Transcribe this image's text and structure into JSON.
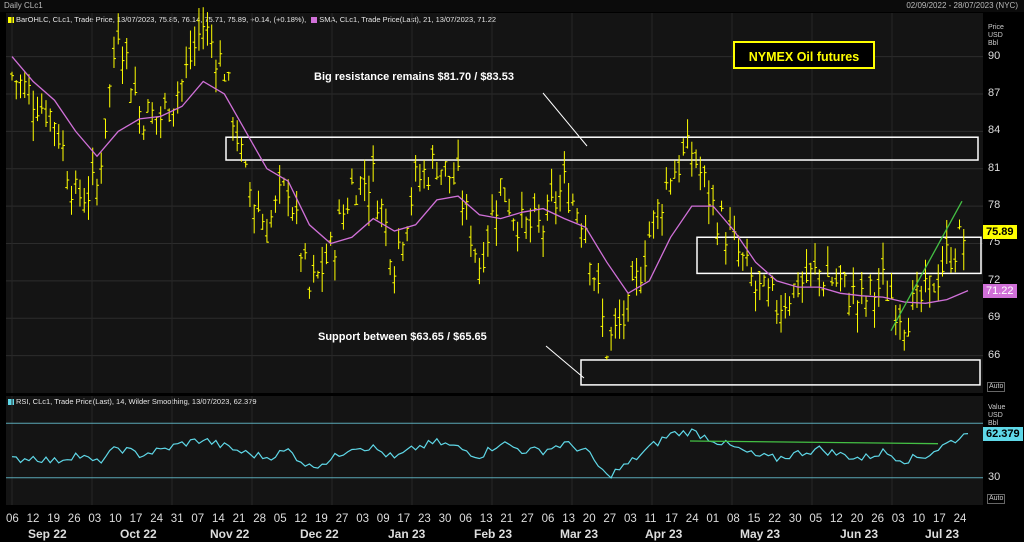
{
  "window": {
    "title": "Daily CLc1",
    "date_range": "02/09/2022 - 28/07/2023 (NYC)"
  },
  "legend": {
    "price_series": "BarOHLC, CLc1, Trade Price, 13/07/2023, 75.85, 76.14, 75.71, 75.89, +0.14, (+0.18%),",
    "sma_series": "SMA, CLc1, Trade Price(Last),  21, 13/07/2023, 71.22",
    "rsi_series": "RSI, CLc1, Trade Price(Last),  14, Wilder Smoothing, 13/07/2023, 62.379"
  },
  "price_axis": {
    "unit_lines": [
      "Price",
      "USD",
      "Bbl"
    ],
    "auto": "Auto"
  },
  "rsi_axis": {
    "unit_lines": [
      "Value",
      "USD",
      "Bbl"
    ],
    "auto": "Auto"
  },
  "annotations": {
    "badge": "NYMEX Oil futures",
    "resistance": "Big resistance remains $81.70 / $83.53",
    "support": "Support between $63.65 / $65.65"
  },
  "colors": {
    "price_bars": "#ffff00",
    "sma": "#d070d8",
    "rsi": "#5fd8e8",
    "trendline": "#44c044",
    "zone_box": "#ffffff",
    "last_price_tag": "#ffff00",
    "sma_tag": "#d070d8",
    "rsi_tag": "#5fd8e8"
  },
  "chart_data": [
    {
      "type": "ohlc",
      "title": "Daily CLc1",
      "ylabel": "Price USD Bbl",
      "ylim": [
        63,
        93.5
      ],
      "yticks": [
        66,
        69,
        72,
        75,
        78,
        81,
        84,
        87,
        90
      ],
      "grid": true,
      "last_price": 75.89,
      "last_sma": 71.22,
      "x": [
        "2022-09-02",
        "2022-09-09",
        "2022-09-16",
        "2022-09-23",
        "2022-09-30",
        "2022-10-07",
        "2022-10-14",
        "2022-10-21",
        "2022-10-28",
        "2022-11-04",
        "2022-11-11",
        "2022-11-18",
        "2022-11-25",
        "2022-12-02",
        "2022-12-09",
        "2022-12-16",
        "2022-12-23",
        "2022-12-30",
        "2023-01-06",
        "2023-01-13",
        "2023-01-20",
        "2023-01-27",
        "2023-02-03",
        "2023-02-10",
        "2023-02-17",
        "2023-02-24",
        "2023-03-03",
        "2023-03-10",
        "2023-03-17",
        "2023-03-24",
        "2023-03-31",
        "2023-04-06",
        "2023-04-14",
        "2023-04-21",
        "2023-04-28",
        "2023-05-05",
        "2023-05-12",
        "2023-05-19",
        "2023-05-26",
        "2023-06-02",
        "2023-06-09",
        "2023-06-16",
        "2023-06-23",
        "2023-06-30",
        "2023-07-07",
        "2023-07-13"
      ],
      "close": [
        88.5,
        86.8,
        85.1,
        78.7,
        79.5,
        92.6,
        85.6,
        85.1,
        87.9,
        92.6,
        89.0,
        80.1,
        76.3,
        79.9,
        71.0,
        74.3,
        79.6,
        80.3,
        73.8,
        79.9,
        81.6,
        79.7,
        73.4,
        79.7,
        76.3,
        76.3,
        79.7,
        76.7,
        66.7,
        69.3,
        75.7,
        80.7,
        82.5,
        77.9,
        74.8,
        71.3,
        70.0,
        71.7,
        72.7,
        71.7,
        70.2,
        71.8,
        69.2,
        70.6,
        73.9,
        75.89
      ],
      "sma": [
        90.0,
        88.0,
        86.5,
        84.0,
        82.0,
        84.0,
        85.0,
        85.2,
        86.0,
        88.0,
        87.0,
        84.0,
        81.0,
        80.0,
        76.5,
        75.0,
        75.5,
        77.0,
        76.0,
        76.5,
        78.5,
        78.8,
        77.3,
        77.0,
        77.5,
        77.8,
        77.0,
        76.3,
        73.5,
        71.0,
        72.0,
        75.5,
        78.0,
        78.0,
        76.0,
        73.5,
        72.0,
        71.5,
        71.5,
        71.0,
        70.8,
        70.7,
        70.3,
        70.2,
        70.5,
        71.22
      ],
      "zones": [
        {
          "name": "Big resistance",
          "low": 81.7,
          "high": 83.53
        },
        {
          "name": "Support",
          "low": 63.65,
          "high": 65.65
        }
      ]
    },
    {
      "type": "line",
      "title": "RSI",
      "series_name": "RSI 14, Wilder Smoothing",
      "yticks": [
        30
      ],
      "last_value": 62.379,
      "values": [
        43,
        45,
        42,
        47,
        41,
        52,
        47,
        50,
        55,
        58,
        53,
        48,
        45,
        50,
        38,
        43,
        53,
        52,
        44,
        52,
        56,
        52,
        46,
        56,
        50,
        50,
        55,
        50,
        31,
        40,
        52,
        62,
        64,
        58,
        52,
        46,
        44,
        48,
        51,
        47,
        44,
        49,
        43,
        46,
        55,
        62.379
      ]
    }
  ],
  "x_axis": {
    "days": [
      "06",
      "12",
      "19",
      "26",
      "03",
      "10",
      "17",
      "24",
      "31",
      "07",
      "14",
      "21",
      "28",
      "05",
      "12",
      "19",
      "27",
      "03",
      "09",
      "17",
      "23",
      "30",
      "06",
      "13",
      "21",
      "27",
      "06",
      "13",
      "20",
      "27",
      "03",
      "11",
      "17",
      "24",
      "01",
      "08",
      "15",
      "22",
      "30",
      "05",
      "12",
      "20",
      "26",
      "03",
      "10",
      "17",
      "24"
    ],
    "months": [
      "Sep 22",
      "Oct 22",
      "Nov 22",
      "Dec 22",
      "Jan 23",
      "Feb 23",
      "Mar 23",
      "Apr 23",
      "May 23",
      "Jun 23",
      "Jul 23"
    ]
  }
}
